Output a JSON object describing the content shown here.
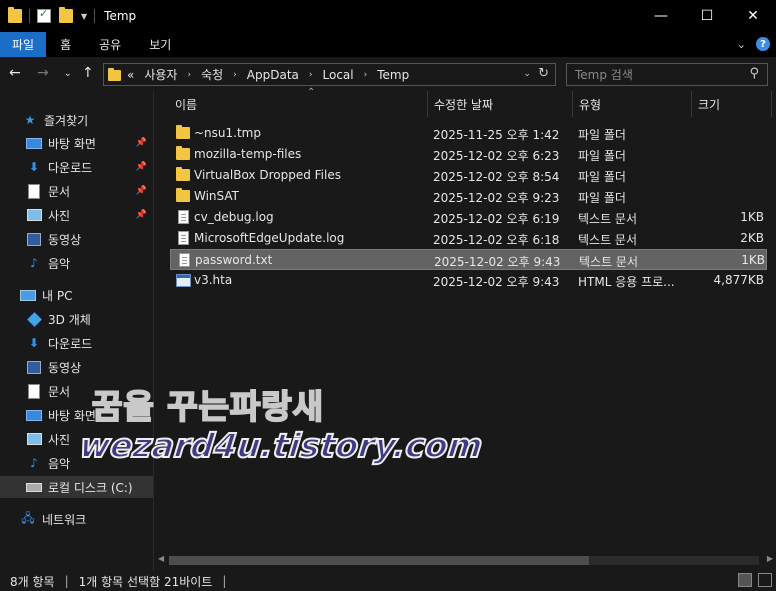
{
  "window": {
    "title": "Temp",
    "controls": {
      "minimize": "—",
      "maximize": "☐",
      "close": "✕"
    }
  },
  "ribbon": {
    "tabs": [
      {
        "label": "파일",
        "active": true
      },
      {
        "label": "홈"
      },
      {
        "label": "공유"
      },
      {
        "label": "보기"
      }
    ],
    "help": "?"
  },
  "address": {
    "prefix": "«",
    "crumbs": [
      "사용자",
      "숙청",
      "AppData",
      "Local",
      "Temp"
    ]
  },
  "search": {
    "placeholder": "Temp 검색"
  },
  "sidebar": {
    "quick_access": {
      "label": "즐겨찾기",
      "items": [
        {
          "label": "바탕 화면",
          "icon": "desktop-icon",
          "pinned": true
        },
        {
          "label": "다운로드",
          "icon": "download-icon",
          "pinned": true
        },
        {
          "label": "문서",
          "icon": "document-icon",
          "pinned": true
        },
        {
          "label": "사진",
          "icon": "pictures-icon",
          "pinned": true
        },
        {
          "label": "동영상",
          "icon": "video-icon"
        },
        {
          "label": "음악",
          "icon": "music-icon"
        }
      ]
    },
    "this_pc": {
      "label": "내 PC",
      "items": [
        {
          "label": "3D 개체",
          "icon": "3d-objects-icon"
        },
        {
          "label": "다운로드",
          "icon": "download-icon"
        },
        {
          "label": "동영상",
          "icon": "video-icon"
        },
        {
          "label": "문서",
          "icon": "document-icon"
        },
        {
          "label": "바탕 화면",
          "icon": "desktop-icon"
        },
        {
          "label": "사진",
          "icon": "pictures-icon"
        },
        {
          "label": "음악",
          "icon": "music-icon"
        },
        {
          "label": "로컬 디스크 (C:)",
          "icon": "drive-icon",
          "selected": true
        }
      ]
    },
    "network": {
      "label": "네트워크"
    }
  },
  "columns": {
    "name": "이름",
    "date": "수정한 날짜",
    "type": "유형",
    "size": "크기"
  },
  "files": [
    {
      "name": "~nsu1.tmp",
      "date": "2025-11-25 오후 1:42",
      "type": "파일 폴더",
      "size": "",
      "icon": "folder-icon"
    },
    {
      "name": "mozilla-temp-files",
      "date": "2025-12-02 오후 6:23",
      "type": "파일 폴더",
      "size": "",
      "icon": "folder-icon"
    },
    {
      "name": "VirtualBox Dropped Files",
      "date": "2025-12-02 오후 8:54",
      "type": "파일 폴더",
      "size": "",
      "icon": "folder-icon"
    },
    {
      "name": "WinSAT",
      "date": "2025-12-02 오후 9:23",
      "type": "파일 폴더",
      "size": "",
      "icon": "folder-icon"
    },
    {
      "name": "cv_debug.log",
      "date": "2025-12-02 오후 6:19",
      "type": "텍스트 문서",
      "size": "1KB",
      "icon": "text-file-icon"
    },
    {
      "name": "MicrosoftEdgeUpdate.log",
      "date": "2025-12-02 오후 6:18",
      "type": "텍스트 문서",
      "size": "2KB",
      "icon": "text-file-icon"
    },
    {
      "name": "password.txt",
      "date": "2025-12-02 오후 9:43",
      "type": "텍스트 문서",
      "size": "1KB",
      "icon": "text-file-icon",
      "selected": true
    },
    {
      "name": "v3.hta",
      "date": "2025-12-02 오후 9:43",
      "type": "HTML 응용 프로...",
      "size": "4,877KB",
      "icon": "hta-file-icon"
    }
  ],
  "status": {
    "count": "8개 항목",
    "selection": "1개 항목 선택함 21바이트"
  },
  "watermark": {
    "line1": "꿈을 꾸는파랑새",
    "line2": "wezard4u.tistory.com"
  },
  "colors": {
    "accent": "#1a6ec8",
    "folder": "#f3c544",
    "selected_row": "#636363"
  }
}
